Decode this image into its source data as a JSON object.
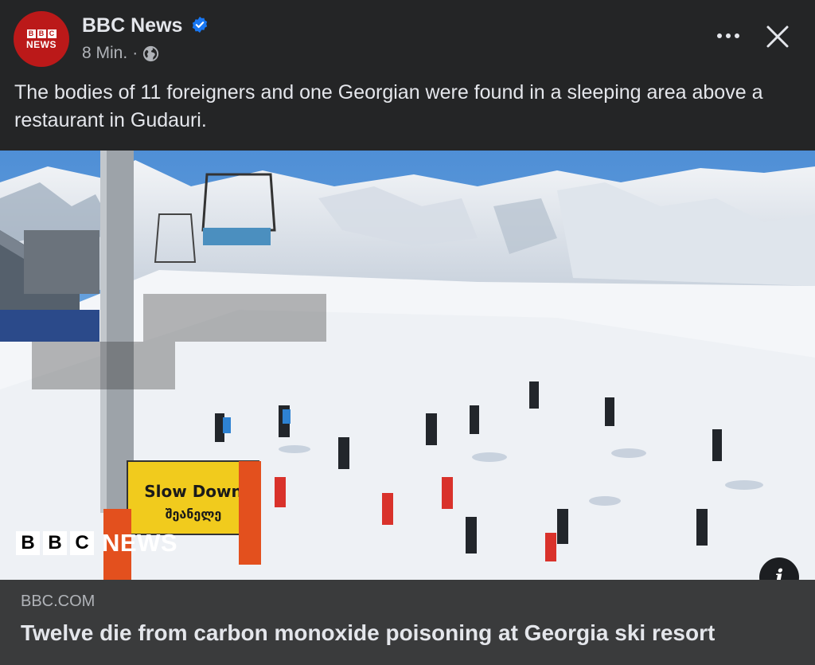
{
  "post": {
    "author_name": "BBC News",
    "timestamp": "8 Min.",
    "separator": "·",
    "avatar": {
      "blocks": [
        "B",
        "B",
        "C"
      ],
      "word": "NEWS"
    },
    "caption": "The bodies of 11 foreigners and one Georgian were found in a sleeping area above a restaurant in Gudauri."
  },
  "photo": {
    "watermark_blocks": [
      "B",
      "B",
      "C"
    ],
    "watermark_word": "NEWS",
    "sign_line1": "Slow Down",
    "sign_line2": "შეანელე"
  },
  "link": {
    "domain": "BBC.COM",
    "title": "Twelve die from carbon monoxide poisoning at Georgia ski resort"
  },
  "icons": {
    "verified": "verified-badge-icon",
    "privacy": "globe-icon",
    "more": "more-options-icon",
    "close": "close-icon",
    "info": "info-icon"
  },
  "colors": {
    "background": "#242526",
    "card": "#3a3b3c",
    "bbc_red": "#bb1919",
    "verified_blue": "#1877f2",
    "text_primary": "#e4e6eb",
    "text_secondary": "#b0b3b8"
  }
}
